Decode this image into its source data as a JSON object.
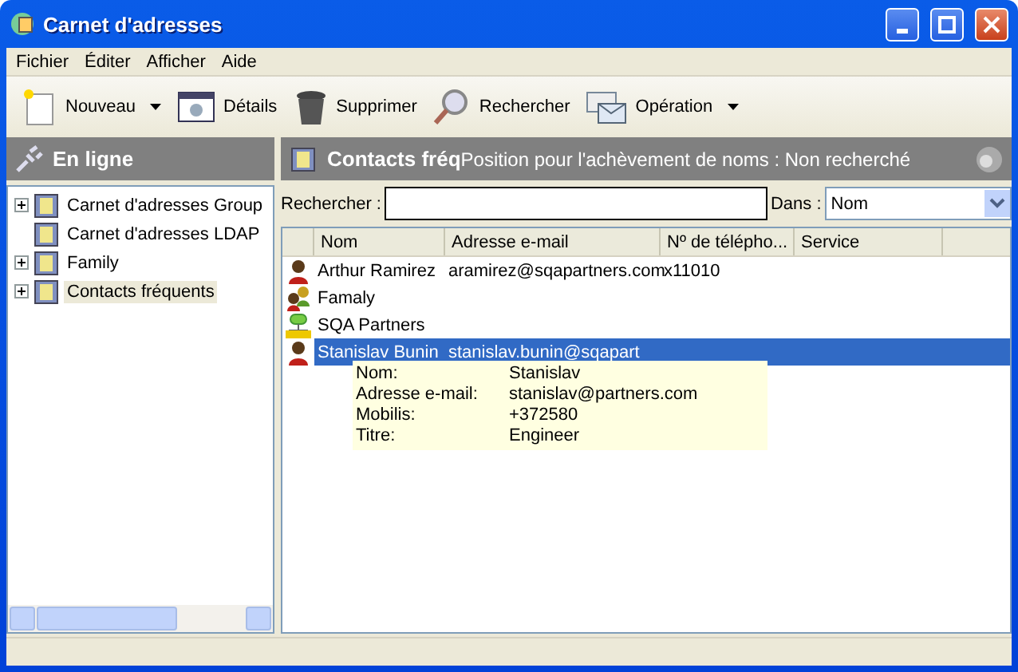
{
  "window": {
    "title": "Carnet d'adresses"
  },
  "menu": [
    "Fichier",
    "Éditer",
    "Afficher",
    "Aide"
  ],
  "toolbar": [
    {
      "label": "Nouveau",
      "kind": "new",
      "dropdown": true
    },
    {
      "label": "Détails",
      "kind": "details",
      "dropdown": false
    },
    {
      "label": "Supprimer",
      "kind": "delete",
      "dropdown": false
    },
    {
      "label": "Rechercher",
      "kind": "search",
      "dropdown": false
    },
    {
      "label": "Opération",
      "kind": "operation",
      "dropdown": true
    }
  ],
  "sidebar": {
    "title": "En ligne",
    "items": [
      {
        "label": "Carnet d'adresses Group",
        "expandable": true,
        "selected": false
      },
      {
        "label": "Carnet d'adresses LDAP",
        "expandable": false,
        "selected": false
      },
      {
        "label": "Family",
        "expandable": true,
        "selected": false
      },
      {
        "label": "Contacts fréquents",
        "expandable": true,
        "selected": true
      }
    ]
  },
  "content": {
    "title": "Contacts fréq",
    "subtitle": "Position pour l'achèvement de noms :  Non recherché",
    "search": {
      "label": "Rechercher :"
    },
    "scope": {
      "label": "Dans :",
      "value": "Nom"
    },
    "table": {
      "columns": [
        "Nom",
        "Adresse e-mail",
        "Nº de télépho...",
        "Service"
      ],
      "rows": [
        {
          "kind": "person",
          "cells": [
            "Arthur Ramirez",
            "aramirez@sqapartners.com",
            "x11010",
            ""
          ],
          "selected": false
        },
        {
          "kind": "group",
          "cells": [
            "Famaly",
            "",
            "",
            ""
          ],
          "selected": false
        },
        {
          "kind": "organization",
          "cells": [
            "SQA Partners",
            "",
            "",
            ""
          ],
          "selected": false
        },
        {
          "kind": "person",
          "cells": [
            "Stanislav Bunin",
            "stanislav.bunin@sqapart",
            "",
            ""
          ],
          "selected": true
        }
      ]
    },
    "tooltip": [
      {
        "label": "Nom:",
        "value": "Stanislav"
      },
      {
        "label": "Adresse e-mail:",
        "value": "stanislav@partners.com"
      },
      {
        "label": "Mobilis:",
        "value": "+372580"
      },
      {
        "label": "Titre:",
        "value": "Engineer"
      }
    ]
  }
}
